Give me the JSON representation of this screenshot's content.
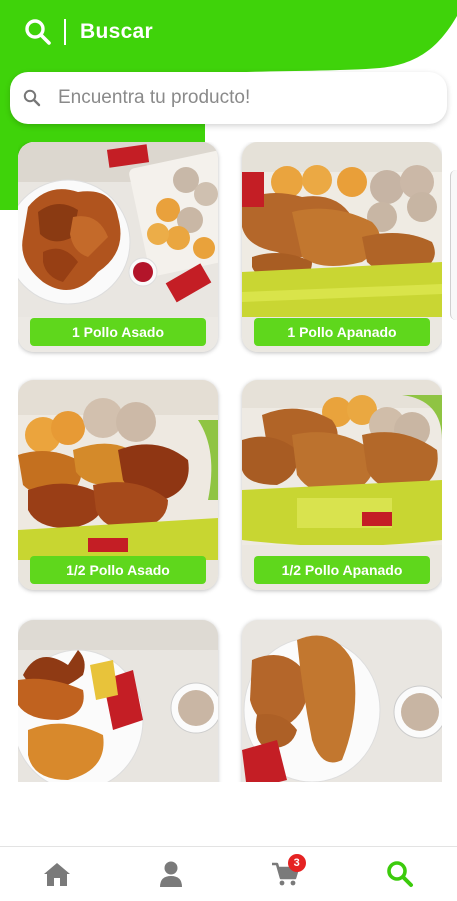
{
  "header": {
    "title": "Buscar"
  },
  "search": {
    "placeholder": "Encuentra tu producto!"
  },
  "products": [
    {
      "label": "1 Pollo Asado",
      "image": "roasted-chicken-plate"
    },
    {
      "label": "1 Pollo Apanado",
      "image": "fried-chicken-basket"
    },
    {
      "label": "1/2 Pollo Asado",
      "image": "half-roasted-chicken-basket"
    },
    {
      "label": "1/2 Pollo Apanado",
      "image": "half-fried-chicken-basket"
    },
    {
      "label": "",
      "image": "roasted-chicken-pieces"
    },
    {
      "label": "",
      "image": "fried-chicken-pieces"
    }
  ],
  "nav": {
    "items": [
      "home-icon",
      "user-icon",
      "cart-icon",
      "search-icon"
    ],
    "cart_badge": "3",
    "active": "search"
  },
  "colors": {
    "brand_green": "#5fd71c",
    "header_green": "#3fd30a",
    "badge_red": "#e52222",
    "inactive_icon": "#777777"
  }
}
